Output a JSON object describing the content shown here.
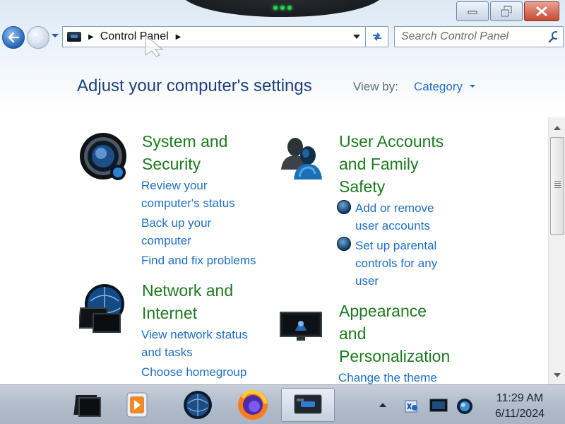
{
  "window": {
    "caption_buttons": [
      "minimize",
      "restore",
      "close"
    ]
  },
  "navbar": {
    "breadcrumb": "Control Panel",
    "search_placeholder": "Search Control Panel"
  },
  "header": {
    "title": "Adjust your computer's settings",
    "view_by_label": "View by:",
    "view_by_value": "Category"
  },
  "categories": [
    {
      "title_line1": "System and",
      "title_line2": "Security",
      "icon": "system-security-icon",
      "links": [
        {
          "line1": "Review your",
          "line2": "computer's status"
        },
        {
          "line1": "Back up your",
          "line2": "computer"
        },
        {
          "line1": "Find and fix problems"
        }
      ]
    },
    {
      "title_line1": "Network and",
      "title_line2": "Internet",
      "icon": "network-internet-icon",
      "links": [
        {
          "line1": "View network status",
          "line2": "and tasks"
        },
        {
          "line1": "Choose homegroup"
        }
      ]
    },
    {
      "title_line1": "User Accounts",
      "title_line2": "and Family",
      "title_line3": "Safety",
      "icon": "user-accounts-icon",
      "links": [
        {
          "line1": "Add or remove",
          "line2": "user accounts"
        },
        {
          "line1": "Set up parental",
          "line2": "controls for any",
          "line3": "user"
        }
      ]
    },
    {
      "title_line1": "Appearance",
      "title_line2": "and",
      "title_line3": "Personalization",
      "icon": "appearance-icon",
      "links": [
        {
          "line1": "Change the theme"
        }
      ]
    }
  ],
  "taskbar": {
    "apps": [
      "file-explorer",
      "media-player",
      "internet-browser",
      "firefox",
      "control-panel"
    ],
    "active_app": "control-panel",
    "clock_time": "11:29 AM",
    "clock_date": "6/11/2024"
  },
  "colors": {
    "category_title": "#1d7a1d",
    "link": "#1f6fc8",
    "heading": "#1e3f7a"
  }
}
